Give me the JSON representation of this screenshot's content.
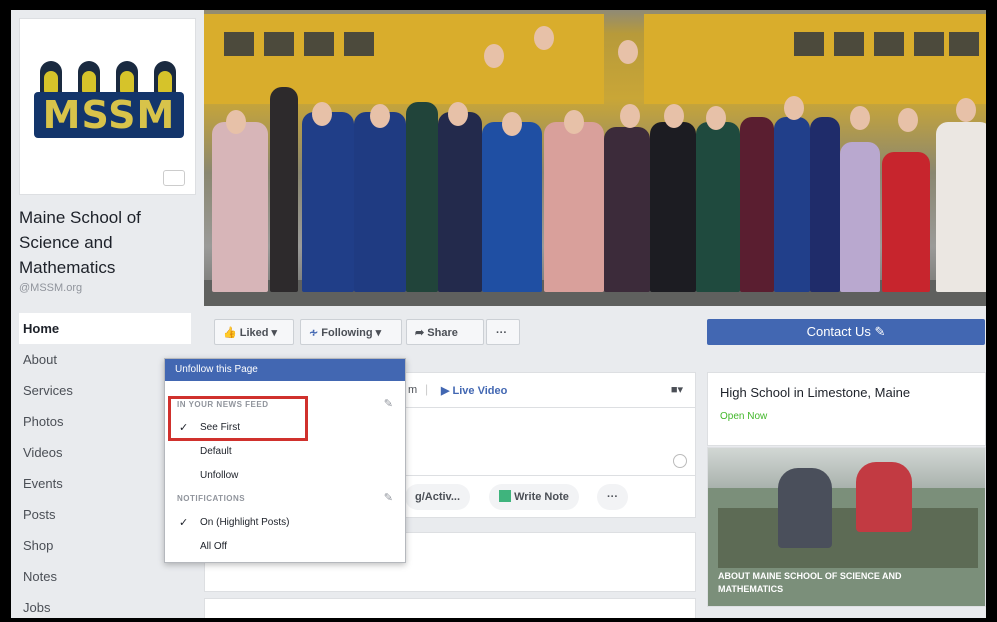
{
  "page": {
    "name": "Maine School of Science and Mathematics",
    "name_lines": [
      "Maine School of",
      "Science and",
      "Mathematics"
    ],
    "handle": "@MSSM.org",
    "logo_text": "MSSM"
  },
  "nav": {
    "items": [
      "Home",
      "About",
      "Services",
      "Photos",
      "Videos",
      "Events",
      "Posts",
      "Shop",
      "Notes",
      "Jobs"
    ],
    "active": "Home"
  },
  "actions": {
    "liked": "Liked",
    "following": "Following",
    "share": "Share",
    "more": "···",
    "contact": "Contact Us"
  },
  "composer": {
    "tab_partial": "m",
    "live_video": "Live Video",
    "activity_partial": "g/Activ...",
    "write_note": "Write Note",
    "more": "···"
  },
  "sidebar": {
    "category": "High School in Limestone, Maine",
    "status": "Open Now",
    "about_caption": "ABOUT MAINE SCHOOL OF SCIENCE AND MATHEMATICS"
  },
  "dropdown": {
    "header": "Unfollow this Page",
    "news_feed_label": "IN YOUR NEWS FEED",
    "feed_options": [
      "See First",
      "Default",
      "Unfollow"
    ],
    "feed_selected": "See First",
    "notifications_label": "NOTIFICATIONS",
    "notification_options": [
      "On (Highlight Posts)",
      "All Off"
    ],
    "notification_selected": "On (Highlight Posts)"
  },
  "colors": {
    "brand_blue": "#4267b2",
    "highlight_red": "#d0312d",
    "open_green": "#42b72a"
  }
}
